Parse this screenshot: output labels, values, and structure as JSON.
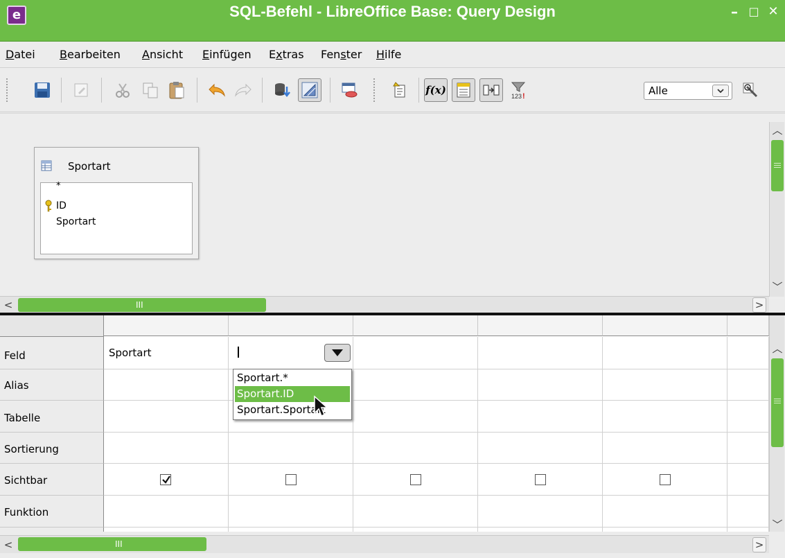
{
  "window": {
    "title": "SQL-Befehl - LibreOffice Base: Query Design",
    "app_icon_glyph": "e",
    "controls": {
      "minimize": "–",
      "maximize": "□",
      "close": "✕"
    },
    "accent_color": "#6dbd47"
  },
  "menubar": {
    "items": [
      {
        "label": "Datei",
        "mnemonic": "D"
      },
      {
        "label": "Bearbeiten",
        "mnemonic": "B"
      },
      {
        "label": "Ansicht",
        "mnemonic": "A"
      },
      {
        "label": "Einfügen",
        "mnemonic": "E"
      },
      {
        "label": "Extras",
        "mnemonic": "x"
      },
      {
        "label": "Fenster",
        "mnemonic": "s"
      },
      {
        "label": "Hilfe",
        "mnemonic": "H"
      }
    ]
  },
  "toolbar": {
    "icons": [
      "save-icon",
      "edit-icon",
      "cut-icon",
      "copy-icon",
      "paste-icon",
      "undo-icon",
      "redo-icon",
      "run-query-icon",
      "design-view-icon",
      "add-table-icon",
      "add-field-icon",
      "functions-icon",
      "table-name-icon",
      "alias-icon",
      "distinct-values-icon",
      "zoom-icon"
    ],
    "functions_label": "f(x)",
    "limit": {
      "value": "Alle"
    }
  },
  "table_window": {
    "name": "Sportart",
    "fields": [
      "*",
      "ID",
      "Sportart"
    ]
  },
  "grid": {
    "row_headers": [
      "Feld",
      "Alias",
      "Tabelle",
      "Sortierung",
      "Sichtbar",
      "Funktion"
    ],
    "columns": [
      {
        "feld": "Sportart",
        "visible": true
      },
      {
        "feld": "",
        "visible": false
      },
      {
        "feld": "",
        "visible": false
      },
      {
        "feld": "",
        "visible": false
      },
      {
        "feld": "",
        "visible": false
      }
    ],
    "dropdown_options": [
      "Sportart.*",
      "Sportart.ID",
      "Sportart.Sportart"
    ],
    "dropdown_selected": "Sportart.ID"
  },
  "scrollbars": {
    "grip": "III"
  }
}
